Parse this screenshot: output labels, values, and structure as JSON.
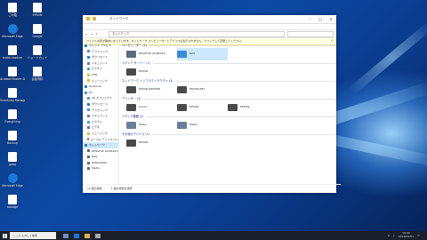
{
  "desktop": {
    "icons_left": [
      {
        "label": "ごみ箱",
        "icon": "recycle-bin-icon"
      },
      {
        "label": "Microsoft Edge",
        "icon": "edge-icon"
      },
      {
        "label": "audio-capture",
        "icon": "file-icon"
      },
      {
        "label": "Acrobat Reader DC",
        "icon": "file-icon"
      },
      {
        "label": "ScanSnap Manager",
        "icon": "file-icon"
      },
      {
        "label": "Everything",
        "icon": "file-icon"
      },
      {
        "label": "Backup",
        "icon": "file-icon"
      },
      {
        "label": "goog",
        "icon": "file-icon"
      },
      {
        "label": "Microsoft Edge",
        "icon": "edge-icon"
      },
      {
        "label": "storage",
        "icon": "file-icon"
      }
    ],
    "icons_col2": [
      {
        "label": "EPSON",
        "icon": "file-icon"
      },
      {
        "label": "Google",
        "icon": "file-icon"
      },
      {
        "label": "ショートカット",
        "icon": "file-icon"
      },
      {
        "label": "会議資料",
        "icon": "file-icon"
      }
    ]
  },
  "explorer": {
    "title": "ネットワーク",
    "address": "ネットワーク",
    "infobar": "ファイル共有が無効になっています。ネットワーク コンピューターとデバイスは表示されません。クリックして変更してください。",
    "nav_items": [
      {
        "label": "クイック アクセス",
        "sel": false,
        "color": "#2b78d6"
      },
      {
        "label": "デスクトップ",
        "sel": false,
        "color": "#4a90d9"
      },
      {
        "label": "ダウンロード",
        "sel": false,
        "color": "#2b78d6"
      },
      {
        "label": "ドキュメント",
        "sel": false,
        "color": "#6a7f99"
      },
      {
        "label": "ピクチャ",
        "sel": false,
        "color": "#4aa0d9"
      },
      {
        "label": "OTR",
        "sel": false,
        "color": "#d9b44a"
      },
      {
        "label": "ミュージック",
        "sel": false,
        "color": "#d9b44a"
      },
      {
        "label": "OneDrive",
        "sel": false,
        "color": "#2b78d6"
      },
      {
        "label": "PC",
        "sel": false,
        "color": "#4a90d9"
      },
      {
        "label": "3D オブジェクト",
        "sel": false,
        "color": "#4aa0d9"
      },
      {
        "label": "ダウンロード",
        "sel": false,
        "color": "#2b78d6"
      },
      {
        "label": "デスクトップ",
        "sel": false,
        "color": "#4a90d9"
      },
      {
        "label": "ドキュメント",
        "sel": false,
        "color": "#6a7f99"
      },
      {
        "label": "ピクチャ",
        "sel": false,
        "color": "#4aa0d9"
      },
      {
        "label": "ビデオ",
        "sel": false,
        "color": "#7a5fb8"
      },
      {
        "label": "ミュージック",
        "sel": false,
        "color": "#d9b44a"
      },
      {
        "label": "ローカル ディスク (C:)",
        "sel": false,
        "color": "#888888"
      },
      {
        "label": "ネットワーク",
        "sel": true,
        "color": "#2b78d6"
      },
      {
        "label": "DESKTOP-QD0RS3H",
        "sel": false,
        "color": "#5c6a80"
      },
      {
        "label": "NAS",
        "sel": false,
        "color": "#5c6a80"
      },
      {
        "label": "PANASONIC",
        "sel": false,
        "color": "#5c6a80"
      },
      {
        "label": "Media",
        "sel": false,
        "color": "#5c6a80"
      }
    ],
    "groups": [
      {
        "title": "コンピューター (2)",
        "items": [
          {
            "name": "DESKTOP-QD0RS3H",
            "sub": "",
            "color": "#5c6a80",
            "sel": false
          },
          {
            "name": "NAS",
            "sub": "",
            "color": "#3b8ad9",
            "sel": true
          }
        ]
      },
      {
        "title": "メディア サーバー (1)",
        "items": [
          {
            "name": "EPSON",
            "sub": "",
            "color": "#4a4a4a",
            "sel": false
          }
        ]
      },
      {
        "title": "ネットワーク インフラストラクチャ (2)",
        "items": [
          {
            "name": "EPSON-PRINTER",
            "sub": "",
            "color": "#4a4a4a",
            "sel": false
          },
          {
            "name": "EPSON-NET",
            "sub": "",
            "color": "#4a4a4a",
            "sel": false
          }
        ]
      },
      {
        "title": "プリンター (3)",
        "items": [
          {
            "name": "Canon",
            "sub": "",
            "color": "#4a4a4a",
            "sel": false
          },
          {
            "name": "EPSON",
            "sub": "",
            "color": "#4a4a4a",
            "sel": false
          },
          {
            "name": "EPSON",
            "sub": "",
            "color": "#4a4a4a",
            "sel": false
          }
        ]
      },
      {
        "title": "メディア機器 (2)",
        "items": [
          {
            "name": "Media",
            "sub": "",
            "color": "#6a7f99",
            "sel": false
          },
          {
            "name": "Media",
            "sub": "",
            "color": "#6a7f99",
            "sel": false
          }
        ]
      },
      {
        "title": "その他のデバイス (1)",
        "items": [
          {
            "name": "EPSON",
            "sub": "",
            "color": "#4a4a4a",
            "sel": false
          }
        ]
      }
    ],
    "status_count": "11 個の項目",
    "status_sel": "1 個の項目を選択"
  },
  "taskbar": {
    "search_placeholder": "ここに入力して検索",
    "time": "10:00",
    "date": "2018/01/01"
  }
}
